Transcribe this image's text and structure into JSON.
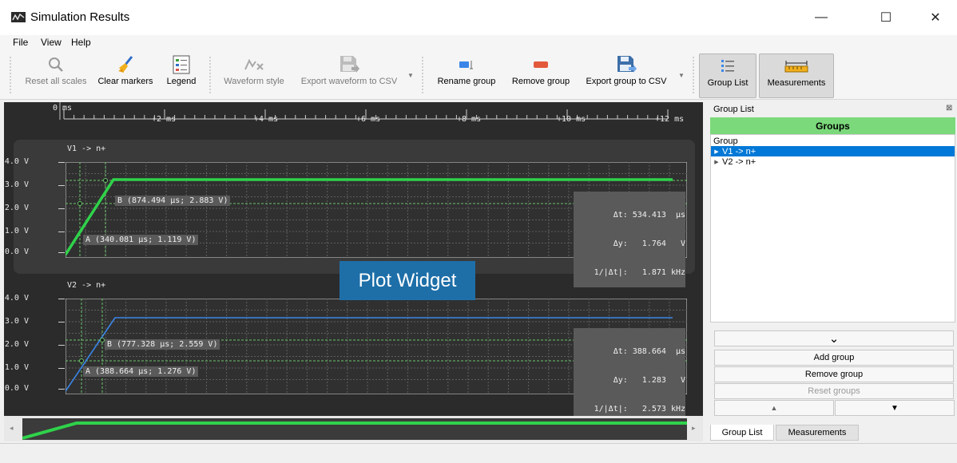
{
  "window": {
    "title": "Simulation Results",
    "minimize_glyph": "—",
    "maximize_glyph": "☐",
    "close_glyph": "✕"
  },
  "menu": [
    "File",
    "View",
    "Help"
  ],
  "toolbar": {
    "reset_scales": "Reset all scales",
    "clear_markers": "Clear markers",
    "legend": "Legend",
    "waveform_style": "Waveform style",
    "export_waveform": "Export waveform to CSV",
    "rename_group": "Rename group",
    "remove_group": "Remove group",
    "export_group": "Export group to CSV",
    "group_list": "Group List",
    "measurements": "Measurements"
  },
  "time_axis": {
    "labels": [
      "0 ms",
      "+2 ms",
      "+4 ms",
      "+6 ms",
      "+8 ms",
      "+10 ms",
      "+12 ms"
    ]
  },
  "plots": [
    {
      "name": "V1 -> n+",
      "y_ticks": [
        "4.0 V",
        "3.0 V",
        "2.0 V",
        "1.0 V",
        "0.0 V"
      ],
      "color": "#2fd24a",
      "marker_a": "A (340.081 µs; 1.119 V)",
      "marker_b": "B (874.494 µs; 2.883 V)",
      "meas": [
        "Δt: 534.413  µs",
        "Δy:   1.764   V",
        "1/|Δt|:   1.871 kHz"
      ]
    },
    {
      "name": "V2 -> n+",
      "y_ticks": [
        "4.0 V",
        "3.0 V",
        "2.0 V",
        "1.0 V",
        "0.0 V"
      ],
      "color": "#3a86e8",
      "marker_a": "A (388.664 µs; 1.276 V)",
      "marker_b": "B (777.328 µs; 2.559 V)",
      "meas": [
        "Δt: 388.664  µs",
        "Δy:   1.283   V",
        "1/|Δt|:   2.573 kHz"
      ]
    }
  ],
  "overlay_label": "Plot Widget",
  "group_panel": {
    "title": "Group List",
    "close_glyph": "⊠",
    "header": "Groups",
    "column": "Group",
    "items": [
      {
        "label": "V1 -> n+",
        "selected": true
      },
      {
        "label": "V2 -> n+",
        "selected": false
      }
    ],
    "collapse_glyph": "⌄",
    "add_group": "Add group",
    "remove_group": "Remove group",
    "reset_groups": "Reset groups",
    "up_glyph": "▲",
    "down_glyph": "▼"
  },
  "bottom_tabs": [
    "Group List",
    "Measurements"
  ],
  "colors": {
    "accent_green": "#7bd97b",
    "selection": "#0078d7",
    "plot_bg": "#2b2b2b",
    "overlay": "#1e6fa8"
  }
}
